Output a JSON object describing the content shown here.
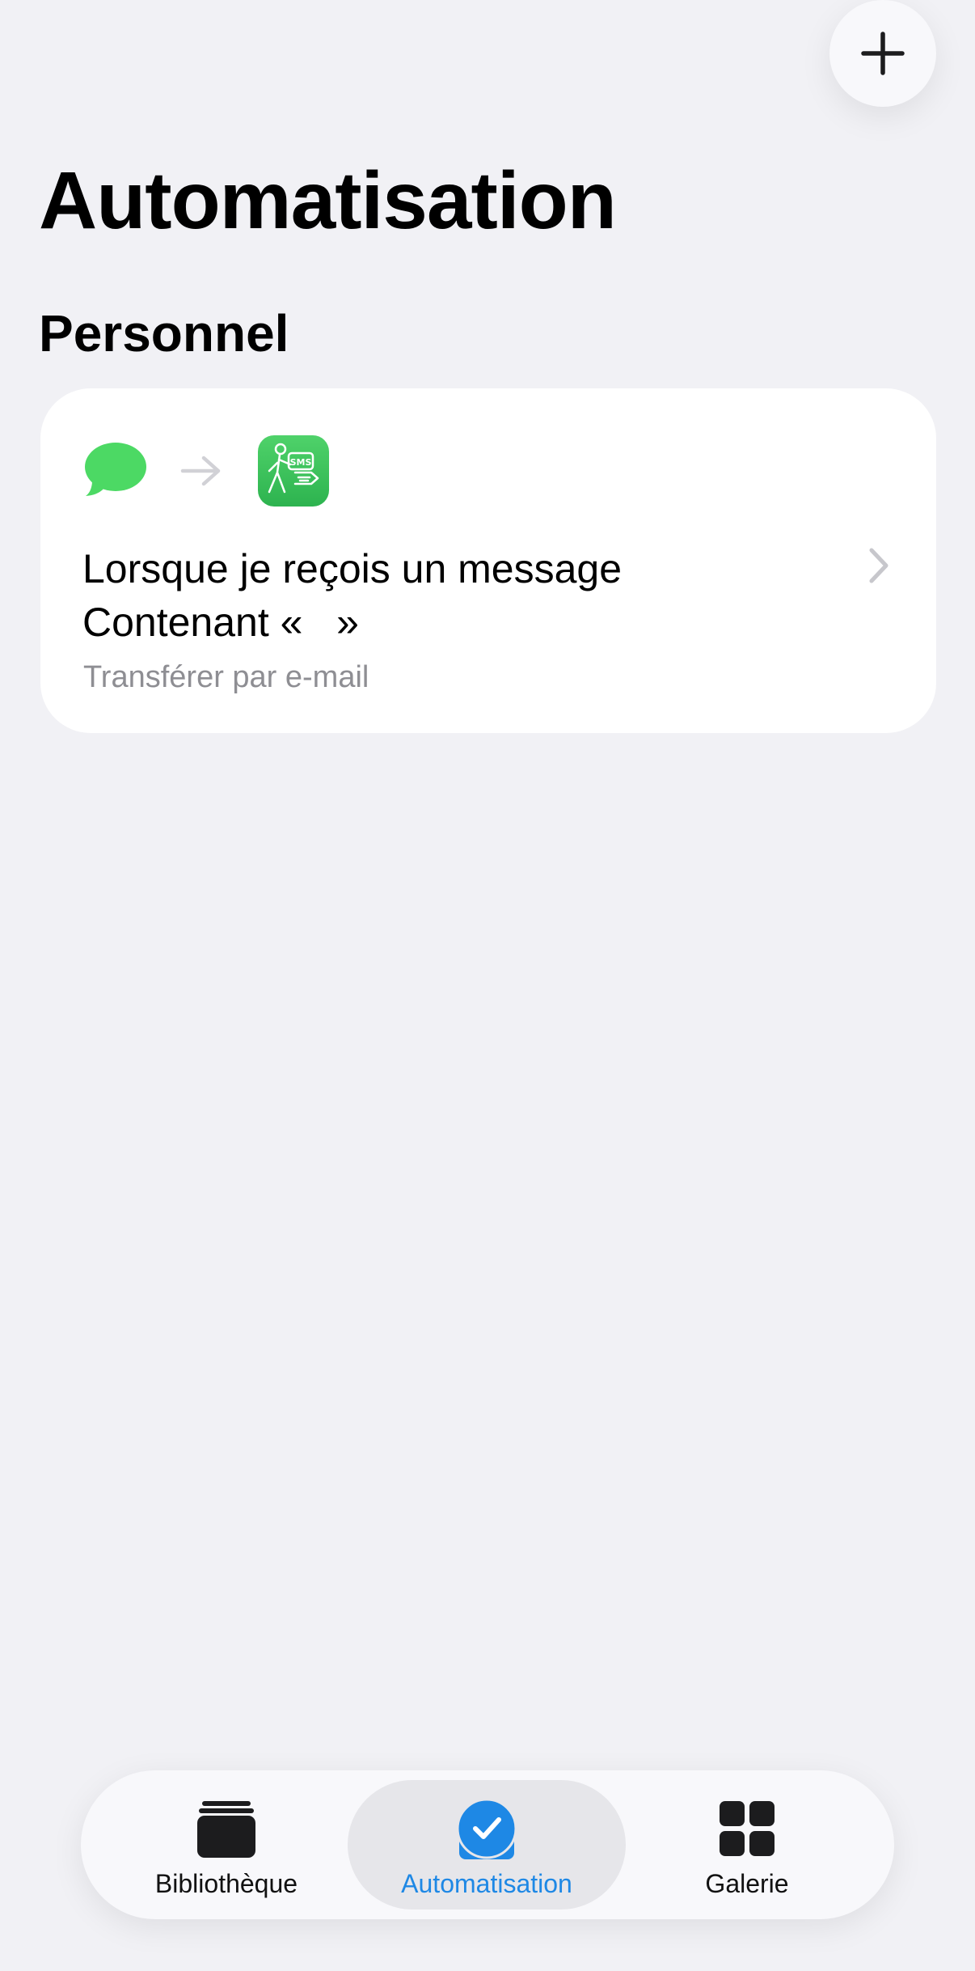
{
  "header": {
    "title": "Automatisation",
    "add_icon": "plus-icon"
  },
  "section": {
    "title": "Personnel"
  },
  "automation_card": {
    "trigger_icon": "messages-icon",
    "arrow_icon": "arrow-right-icon",
    "action_icon": "sms-forward-icon",
    "action_icon_text": "SMS",
    "title_line_1": "Lorsque je reçois un message",
    "title_line_2": "Contenant «   »",
    "subtitle": "Transférer par e-mail",
    "chevron_icon": "chevron-right-icon"
  },
  "tab_bar": {
    "tabs": [
      {
        "label": "Bibliothèque",
        "icon": "library-icon",
        "selected": false
      },
      {
        "label": "Automatisation",
        "icon": "automation-icon",
        "selected": true
      },
      {
        "label": "Galerie",
        "icon": "gallery-icon",
        "selected": false
      }
    ]
  },
  "colors": {
    "background": "#f1f1f5",
    "card": "#ffffff",
    "accent": "#1e88e5",
    "messages_green": "#4cd964",
    "secondary_text": "#8e8e93"
  }
}
